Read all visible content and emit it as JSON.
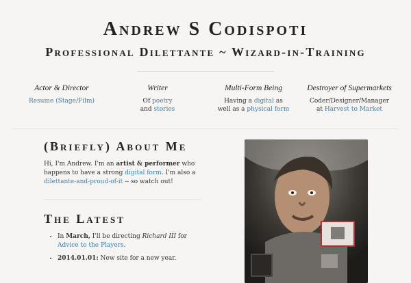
{
  "header": {
    "title": "Andrew S Codispoti",
    "subtitle": "Professional Dilettante ~ Wizard-in-Training"
  },
  "roles": [
    {
      "title": "Actor & Director",
      "line1_link": "Resume (Stage/Film)"
    },
    {
      "title": "Writer",
      "line1_pre": "Of ",
      "line1_link": "poetry",
      "line2_pre": "and ",
      "line2_link": "stories"
    },
    {
      "title": "Multi-Form Being",
      "line1_pre": "Having a ",
      "line1_link": "digital",
      "line1_post": " as",
      "line2_pre": "well as a ",
      "line2_link": "physical form"
    },
    {
      "title": "Destroyer of Supermarkets",
      "line1_pre": "Coder/Designer/Manager",
      "line2_pre": "at ",
      "line2_link": "Harvest to Market"
    }
  ],
  "about": {
    "title": "(Briefly) About Me",
    "t1": "Hi, I'm Andrew. I'm an ",
    "b1": "artist & performer",
    "t2": " who happens to have a strong ",
    "l1": "digital form",
    "t3": ". I'm also a ",
    "l2": "dilettante-and-proud-of-it",
    "t4": " -- so watch out!"
  },
  "latest": {
    "title": "The Latest",
    "items": [
      {
        "pre": "In ",
        "bold": "March,",
        "mid": " I'll be directing ",
        "italic": "Richard III",
        "mid2": " for ",
        "link": "Advice to the Players",
        "post": "."
      },
      {
        "bold": "2014.01.01:",
        "mid": " New site for a new year."
      }
    ]
  },
  "colors": {
    "background": "#f6f5f3",
    "link": "#3b7fb6",
    "text": "#222222"
  }
}
